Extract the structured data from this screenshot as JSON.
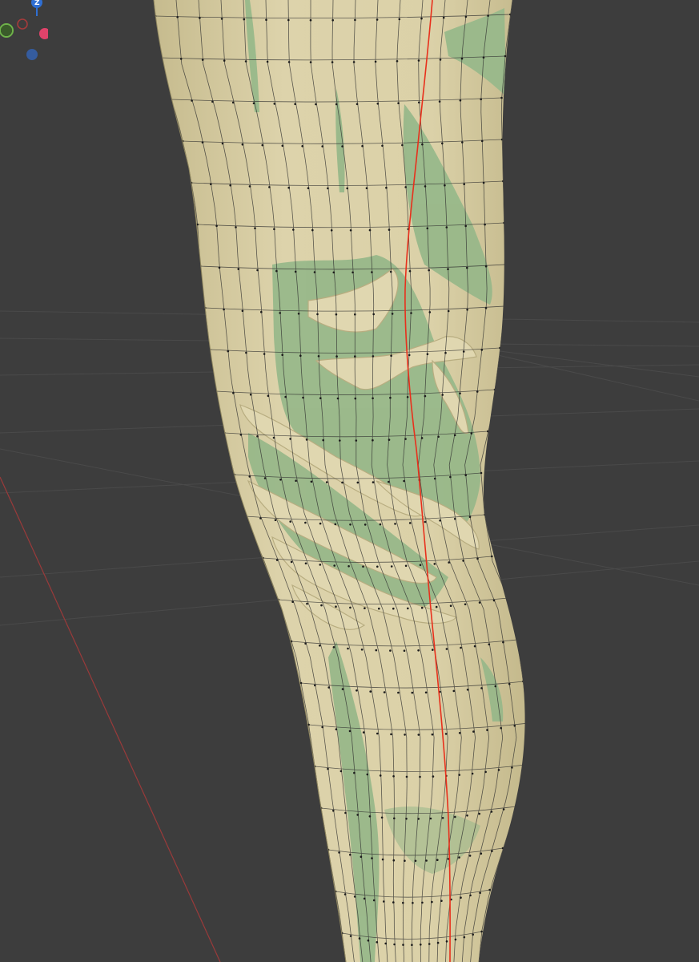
{
  "app": "3D viewport",
  "colors": {
    "background": "#3d3d3d",
    "grid": "#4a4a4a",
    "x_axis": "#9a3a3a",
    "mesh_skin": "#d9cfa6",
    "mesh_mask": "#98b88a",
    "wire": "#2e2e2e",
    "seam": "#e8301c"
  },
  "gizmo": {
    "z_label": "Z",
    "axes": [
      "z-axis",
      "y-axis",
      "x-axis",
      "neg-x-axis",
      "neg-y-axis",
      "neg-z-axis"
    ]
  },
  "mesh": {
    "object": "leg",
    "shading": "solid",
    "overlays": [
      "wireframe",
      "mask",
      "seam"
    ]
  }
}
